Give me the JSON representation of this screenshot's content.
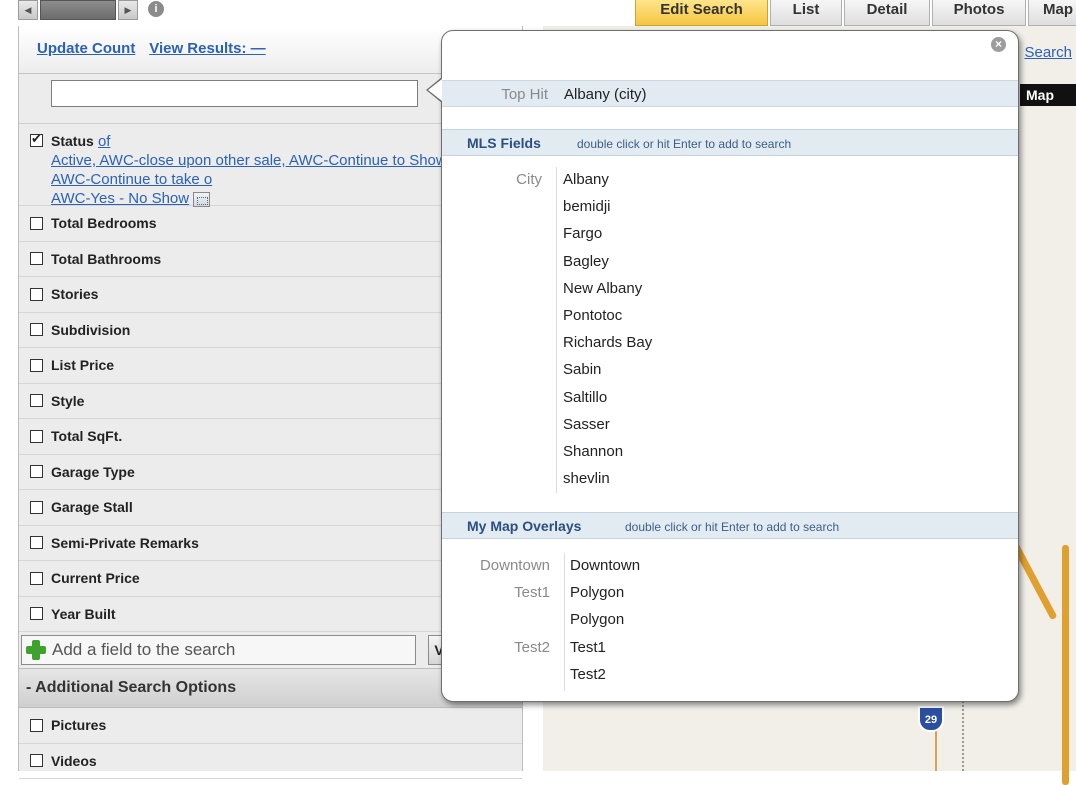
{
  "tabs": [
    {
      "label": "Edit Search",
      "active": true
    },
    {
      "label": "List",
      "active": false
    },
    {
      "label": "Detail",
      "active": false
    },
    {
      "label": "Photos",
      "active": false
    },
    {
      "label": "Map",
      "active": false
    }
  ],
  "header": {
    "update_count": "Update Count",
    "view_results": "View Results: —"
  },
  "search": {
    "value": "",
    "placeholder": ""
  },
  "status_field": {
    "label": "Status",
    "of": "of",
    "values": "Active, AWC-close upon other sale, AWC-Continue to Show, AWC-Continue to take o",
    "values_line3": "AWC-Yes - No Show",
    "checked": true
  },
  "fields": [
    "Total Bedrooms",
    "Total Bathrooms",
    "Stories",
    "Subdivision",
    "List Price",
    "Style",
    "Total SqFt.",
    "Garage Type",
    "Garage Stall",
    "Semi-Private Remarks",
    "Current Price",
    "Year Built"
  ],
  "add_field": {
    "label": "Add a field to the search",
    "button": "V"
  },
  "additional_options": {
    "header": "- Additional Search Options",
    "items": [
      "Pictures",
      "Videos"
    ]
  },
  "map": {
    "label": "Map",
    "search_link": "Search",
    "highway": "29"
  },
  "popup": {
    "top_hit_key": "Top Hit",
    "top_hit_value": "Albany  (city)",
    "mls_title": "MLS Fields",
    "mls_hint": "double click or hit Enter to add to search",
    "city_key": "City",
    "cities": [
      "Albany",
      "bemidji",
      "Fargo",
      "Bagley",
      "New Albany",
      "Pontotoc",
      "Richards Bay",
      "Sabin",
      "Saltillo",
      "Sasser",
      "Shannon",
      "shevlin"
    ],
    "overlays_title": "My Map Overlays",
    "overlays_hint": "double click or hit Enter to add to search",
    "overlay_groups": [
      {
        "key": "Downtown",
        "items": [
          "Downtown"
        ]
      },
      {
        "key": "Test1",
        "items": [
          "Polygon",
          "Polygon"
        ]
      },
      {
        "key": "Test2",
        "items": [
          "Test1",
          "Test2"
        ]
      }
    ]
  },
  "colors": {
    "link": "#2b62b5",
    "active_tab": "#f5c542",
    "section_header_bg": "#e2ebf2"
  }
}
